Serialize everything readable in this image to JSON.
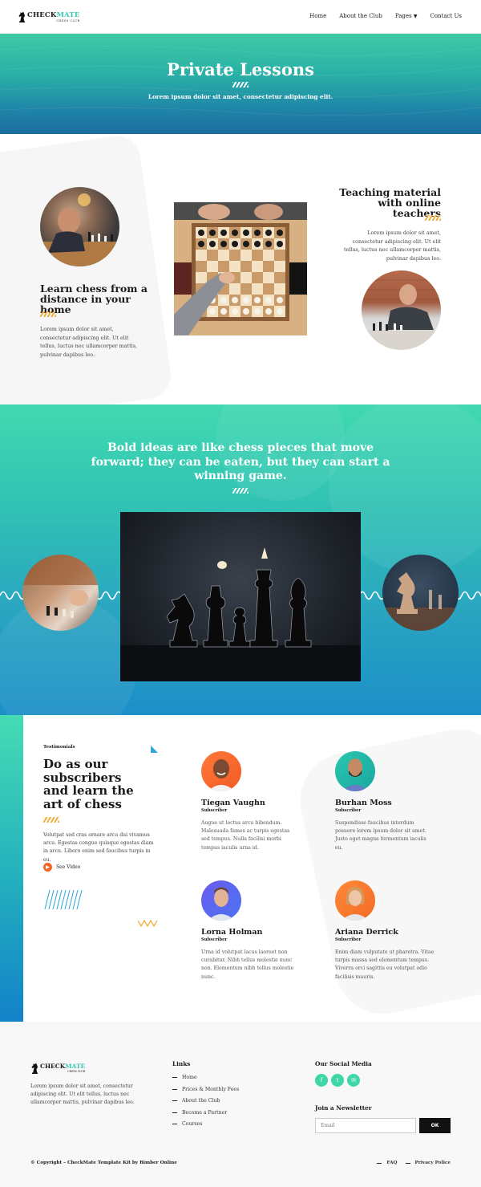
{
  "brand": {
    "name_a": "CHECK",
    "name_b": "MATE",
    "tagline": "CHESS CLUB"
  },
  "nav": {
    "home": "Home",
    "about": "About the Club",
    "pages": "Pages",
    "contact": "Contact Us"
  },
  "hero": {
    "title": "Private Lessons",
    "subtitle": "Lorem ipsum dolor sit amet, consectetur adipiscing elit."
  },
  "lessons": {
    "left_title": "Learn chess from a distance in your home",
    "left_text": "Lorem ipsum dolor sit amet, consectetur adipiscing elit. Ut elit tellus, luctus nec ullamcorper mattis, pulvinar dapibus leo.",
    "right_title": "Teaching material with online teachers",
    "right_text": "Lorem ipsum dolor sit amet, consectetur adipiscing elit. Ut elit tellus, luctus nec ullamcorper mattis, pulvinar dapibus leo."
  },
  "quote": {
    "text": "Bold ideas are like chess pieces that move forward; they can be eaten, but they can start a winning game."
  },
  "testimonials": {
    "eyebrow": "Testimonials",
    "heading": "Do as our subscribers and learn the art of chess",
    "text": "Volutpat sed cras ornare arcu dui vivamus arcu. Egestas congue quisque egestas diam in arcu. Libero enim sed faucibus turpis in eu.",
    "video_label": "See Video",
    "items": [
      {
        "name": "Tiegan Vaughn",
        "role": "Subscriber",
        "text": "Augue ut lectus arcu bibendum. Malesuada fames ac turpis egestas sed tempus. Nulla facilisi morbi tempus iaculis urna id."
      },
      {
        "name": "Burhan Moss",
        "role": "Subscriber",
        "text": "Suspendisse faucibus interdum posuere lorem ipsum dolor sit amet. Justo eget magna fermentum iaculis eu."
      },
      {
        "name": "Lorna Holman",
        "role": "Subscriber",
        "text": "Urna id volutpat lacus laoreet non curabitur. Nibh tellus molestie nunc non. Elementum nibh tellus molestie nunc."
      },
      {
        "name": "Ariana Derrick",
        "role": "Subscriber",
        "text": "Enim diam vulputate ut pharetra. Vitae turpis massa sed elementum tempus. Viverra orci sagittis eu volutpat odio facilisis mauris."
      }
    ]
  },
  "footer": {
    "about": "Lorem ipsum dolor sit amet, consectetur adipiscing elit. Ut elit tellus, luctus nec ullamcorper mattis, pulvinar dapibus leo.",
    "links_title": "Links",
    "links": [
      "Home",
      "Prices & Monthly Fees",
      "About the Club",
      "Become a Partner",
      "Courses"
    ],
    "social_title": "Our Social Media",
    "newsletter_title": "Join a Newsletter",
    "email_placeholder": "Email",
    "ok_label": "OK",
    "copyright": "© Copyright – CheckMate Template Kit by Bimber Online",
    "faq": "FAQ",
    "privacy": "Privacy Police"
  },
  "icons": {
    "facebook": "facebook-icon",
    "twitter": "twitter-icon",
    "email": "email-icon",
    "play": "play-icon",
    "dropdown": "chevron-down-icon"
  },
  "colors": {
    "accent": "#3fd6a8",
    "stripe": "#f0b040",
    "play": "#f26522",
    "dark": "#111111"
  }
}
